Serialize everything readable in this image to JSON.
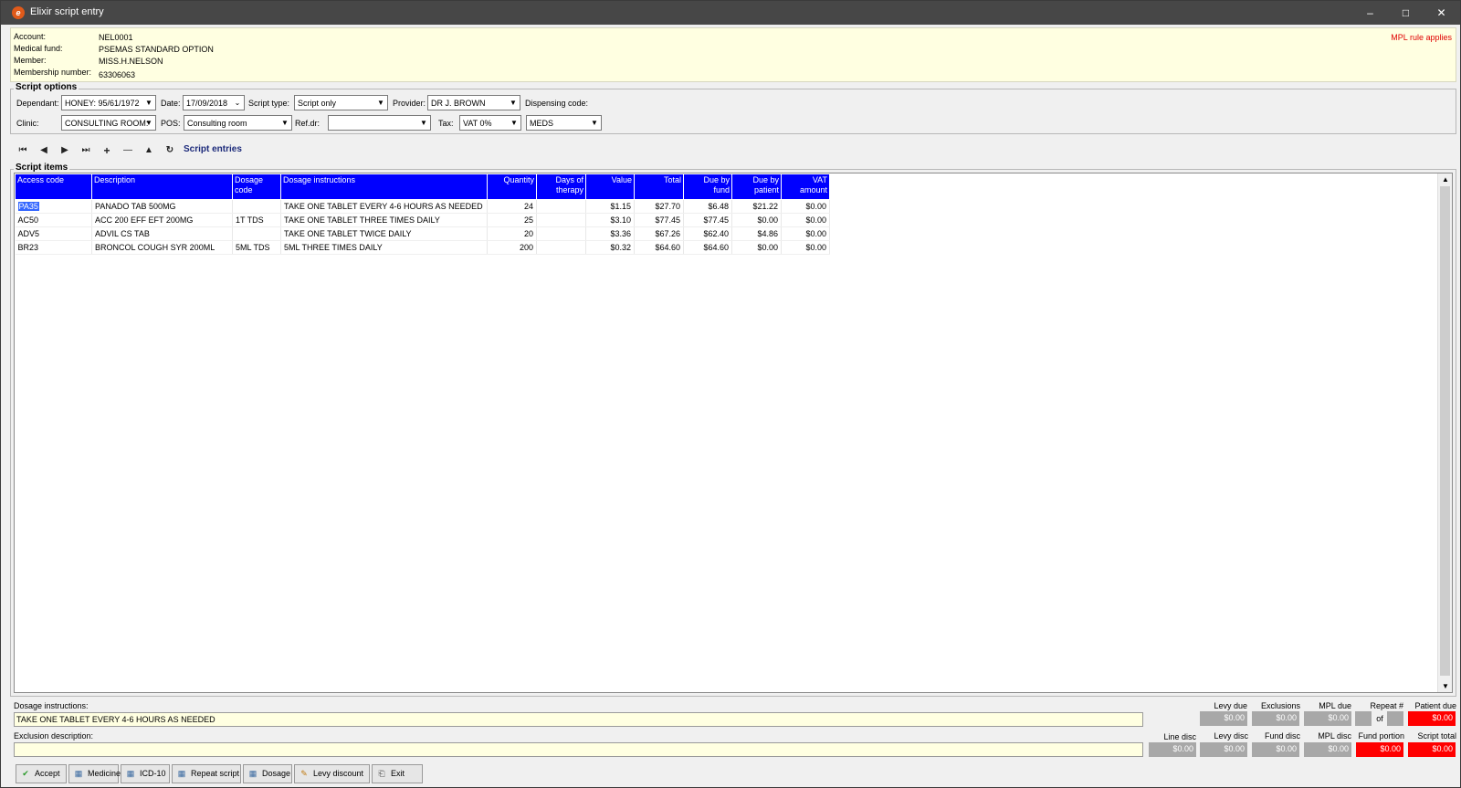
{
  "window": {
    "title": "Elixir script entry",
    "icon": "elixir-app-icon",
    "min_glyph": "–",
    "max_glyph": "□",
    "close_glyph": "✕"
  },
  "account_info": {
    "rows": [
      {
        "label": "Account:",
        "value": "NEL0001"
      },
      {
        "label": "Medical fund:",
        "value": "PSEMAS STANDARD OPTION"
      },
      {
        "label": "Member:",
        "value": "MISS.H.NELSON"
      },
      {
        "label": "Membership number:",
        "value": "63306063"
      }
    ],
    "mpl_rule": "MPL rule applies"
  },
  "script_options": {
    "legend": "Script options",
    "dependant_label": "Dependant:",
    "dependant_value": "HONEY: 95/61/1972",
    "date_label": "Date:",
    "date_value": "17/09/2018",
    "script_type_label": "Script type:",
    "script_type_value": "Script only",
    "provider_label": "Provider:",
    "provider_value": "DR J. BROWN",
    "dispensing_code_label": "Dispensing code:",
    "clinic_label": "Clinic:",
    "clinic_value": "CONSULTING ROOM:",
    "pos_label": "POS:",
    "pos_value": "Consulting room",
    "refdr_label": "Ref.dr:",
    "refdr_value": "",
    "tax_label": "Tax:",
    "tax_value": "VAT 0%",
    "dispensing_code_value": "MEDS"
  },
  "navigator": {
    "buttons": [
      {
        "name": "first-record",
        "glyph": "⏮"
      },
      {
        "name": "prior-record",
        "glyph": "◀"
      },
      {
        "name": "next-record",
        "glyph": "▶"
      },
      {
        "name": "last-record",
        "glyph": "⏭"
      },
      {
        "name": "insert-record",
        "glyph": "+"
      },
      {
        "name": "delete-record",
        "glyph": "—"
      },
      {
        "name": "edit-record",
        "glyph": "▲"
      },
      {
        "name": "refresh",
        "glyph": "↻"
      }
    ],
    "entries_label": "Script entries"
  },
  "script_items": {
    "legend": "Script items",
    "columns": [
      "Access code",
      "Description",
      "Dosage code",
      "Dosage instructions",
      "Quantity",
      "Days of therapy",
      "Value",
      "Total",
      "Due by fund",
      "Due by patient",
      "VAT amount"
    ],
    "rows": [
      [
        "PA35",
        "PANADO TAB 500MG",
        "",
        "TAKE ONE TABLET EVERY 4-6 HOURS AS NEEDED",
        "24",
        "",
        "$1.15",
        "$27.70",
        "$6.48",
        "$21.22",
        "$0.00"
      ],
      [
        "AC50",
        "ACC 200 EFF EFT 200MG",
        "1T TDS",
        "TAKE ONE TABLET THREE TIMES DAILY",
        "25",
        "",
        "$3.10",
        "$77.45",
        "$77.45",
        "$0.00",
        "$0.00"
      ],
      [
        "ADV5",
        "ADVIL CS TAB",
        "",
        "TAKE ONE TABLET TWICE DAILY",
        "20",
        "",
        "$3.36",
        "$67.26",
        "$62.40",
        "$4.86",
        "$0.00"
      ],
      [
        "BR23",
        "BRONCOL COUGH SYR 200ML",
        "5ML TDS",
        "5ML THREE TIMES DAILY",
        "200",
        "",
        "$0.32",
        "$64.60",
        "$64.60",
        "$0.00",
        "$0.00"
      ]
    ],
    "scroll_up": "▲",
    "scroll_down": "▼"
  },
  "details": {
    "dosage_instructions_label": "Dosage instructions:",
    "dosage_instructions_value": "TAKE ONE TABLET EVERY 4-6 HOURS AS NEEDED",
    "exclusion_description_label": "Exclusion description:",
    "exclusion_description_value": ""
  },
  "summary": {
    "row1": {
      "levy_due_label": "Levy due",
      "levy_due": "$0.00",
      "exclusions_label": "Exclusions",
      "exclusions": "$0.00",
      "mpl_due_label": "MPL due",
      "mpl_due": "$0.00",
      "repeat_label": "Repeat #",
      "repeat_of": "of",
      "patient_due_label": "Patient due",
      "patient_due": "$0.00"
    },
    "row2": {
      "line_disc_label": "Line disc",
      "line_disc": "$0.00",
      "levy_disc_label": "Levy disc",
      "levy_disc": "$0.00",
      "fund_disc_label": "Fund disc",
      "fund_disc": "$0.00",
      "mpl_disc_label": "MPL disc",
      "mpl_disc": "$0.00",
      "fund_portion_label": "Fund portion",
      "fund_portion": "$0.00",
      "script_total_label": "Script total",
      "script_total": "$0.00"
    },
    "colors": {
      "red": "#ff0000",
      "grey": "#a8a8a8"
    }
  },
  "buttons": [
    {
      "name": "accept-button",
      "label": "Accept",
      "icon": "checkmark-icon",
      "glyph": "✔"
    },
    {
      "name": "medicine-button",
      "label": "Medicine",
      "icon": "grid-icon",
      "glyph": "▦"
    },
    {
      "name": "icd10-button",
      "label": "ICD-10",
      "icon": "grid-icon",
      "glyph": "▦"
    },
    {
      "name": "repeat-script-button",
      "label": "Repeat script",
      "icon": "grid-icon",
      "glyph": "▦"
    },
    {
      "name": "dosage-button",
      "label": "Dosage",
      "icon": "grid-icon",
      "glyph": "▦"
    },
    {
      "name": "levy-discount-button",
      "label": "Levy discount",
      "icon": "pencil-icon",
      "glyph": "✎"
    },
    {
      "name": "exit-button",
      "label": "Exit",
      "icon": "exit-icon",
      "glyph": "⎗"
    }
  ],
  "colors": {
    "header_blue": "#0000ff",
    "info_yellow": "#ffffe1",
    "title_bar": "#474747",
    "accent_red": "#e00000"
  }
}
